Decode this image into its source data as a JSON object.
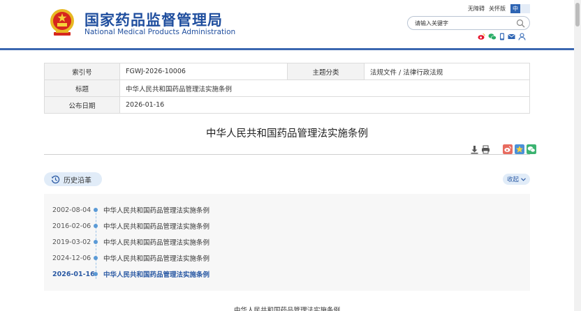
{
  "header": {
    "title_cn": "国家药品监督管理局",
    "title_en": "National Medical Products Administration",
    "accessibility": "无障碍",
    "elder_mode": "关怀版",
    "lang_cn": "中",
    "lang_en": "",
    "search_placeholder": "请输入关键字",
    "social_icons": [
      "weibo-icon",
      "wechat-icon",
      "mobile-icon",
      "mail-icon",
      "user-icon"
    ],
    "brand_color": "#1f4e9e"
  },
  "info": {
    "index_label": "索引号",
    "index_value": "FGWJ-2026-10006",
    "category_label": "主题分类",
    "category_value": "法规文件 / 法律行政法规",
    "title_label": "标题",
    "title_value": "中华人民共和国药品管理法实施条例",
    "date_label": "公布日期",
    "date_value": "2026-01-16"
  },
  "document": {
    "title": "中华人民共和国药品管理法实施条例",
    "tools": [
      "download-icon",
      "print-icon",
      "share-weibo-icon",
      "share-qzone-icon",
      "share-wechat-icon"
    ],
    "body_first_line": "中华人民共和国药品管理法实施条例"
  },
  "history": {
    "label": "历史沿革",
    "collapse_label": "收起",
    "items": [
      {
        "date": "2002-08-04",
        "name": "中华人民共和国药品管理法实施条例"
      },
      {
        "date": "2016-02-06",
        "name": "中华人民共和国药品管理法实施条例"
      },
      {
        "date": "2019-03-02",
        "name": "中华人民共和国药品管理法实施条例"
      },
      {
        "date": "2024-12-06",
        "name": "中华人民共和国药品管理法实施条例"
      },
      {
        "date": "2026-01-16",
        "name": "中华人民共和国药品管理法实施条例"
      }
    ]
  }
}
